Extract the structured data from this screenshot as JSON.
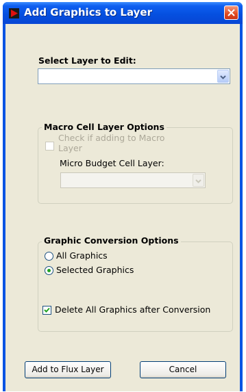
{
  "window": {
    "title": "Add Graphics to Layer"
  },
  "select_layer": {
    "label": "Select Layer to Edit:",
    "value": ""
  },
  "macro_group": {
    "title": "Macro Cell Layer Options",
    "checkbox_label_line1": "Check if adding to Macro",
    "checkbox_label_line2": "Layer",
    "micro_label": "Micro Budget Cell Layer:",
    "micro_value": ""
  },
  "conversion_group": {
    "title": "Graphic Conversion Options",
    "options": [
      "All Graphics",
      "Selected Graphics"
    ],
    "selected": "Selected Graphics",
    "delete_label": "Delete All Graphics after Conversion",
    "delete_checked": true
  },
  "buttons": {
    "add": "Add to Flux Layer",
    "cancel": "Cancel"
  },
  "colors": {
    "titlebar": "#0550e0",
    "client": "#ece9d8",
    "close": "#e0491f",
    "radio_dot": "#21a121",
    "check_mark": "#21a121"
  }
}
